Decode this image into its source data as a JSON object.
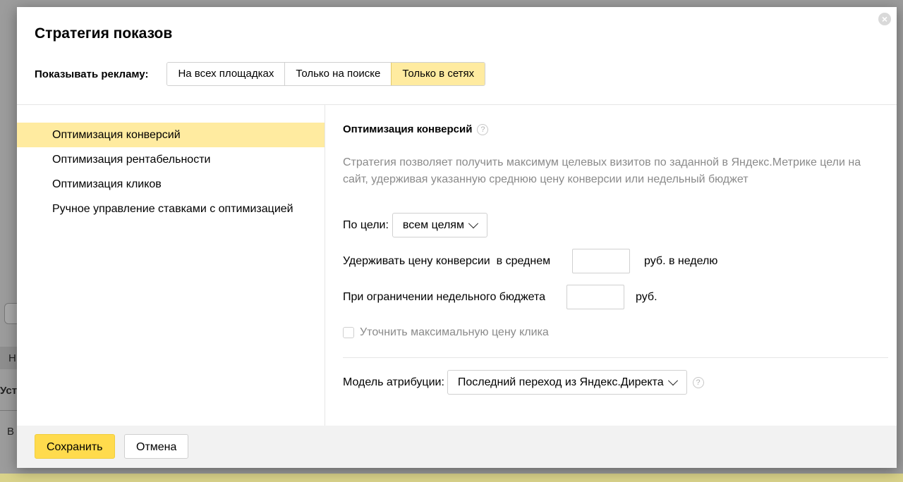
{
  "background": {
    "fragments": [
      "Н",
      "Уста",
      "В"
    ]
  },
  "modal": {
    "title": "Стратегия показов",
    "close_glyph": "×",
    "show_ads": {
      "label": "Показывать рекламу:",
      "options": [
        "На всех площадках",
        "Только на поиске",
        "Только в сетях"
      ],
      "selected": "Только в сетях"
    },
    "strategies": [
      {
        "label": "Оптимизация конверсий",
        "active": true
      },
      {
        "label": "Оптимизация рентабельности",
        "active": false
      },
      {
        "label": "Оптимизация кликов",
        "active": false
      },
      {
        "label": "Ручное управление ставками с оптимизацией",
        "active": false
      }
    ],
    "detail": {
      "title": "Оптимизация конверсий",
      "help_glyph": "?",
      "description": "Стратегия позволяет получить максимум целевых визитов по заданной в Яндекс.Метрике цели на сайт, удерживая указанную среднюю цену конверсии или недельный бюджет",
      "goal": {
        "label": "По цели:",
        "value": "всем целям"
      },
      "avg_price": {
        "label": "Удерживать цену конверсии  в среднем",
        "value": "",
        "unit": "руб. в неделю"
      },
      "weekly_budget": {
        "label": "При ограничении недельного бюджета",
        "value": "",
        "unit": "руб."
      },
      "max_click": {
        "label": "Уточнить максимальную цену клика",
        "checked": false
      },
      "attribution": {
        "label": "Модель атрибуции:",
        "value": "Последний переход из Яндекс.Директа"
      }
    },
    "footer": {
      "save_label": "Сохранить",
      "cancel_label": "Отмена"
    }
  },
  "colors": {
    "accent_yellow": "#ffdb4d",
    "selected_bg": "#ffeba0",
    "muted_text": "#8a8a8a"
  }
}
